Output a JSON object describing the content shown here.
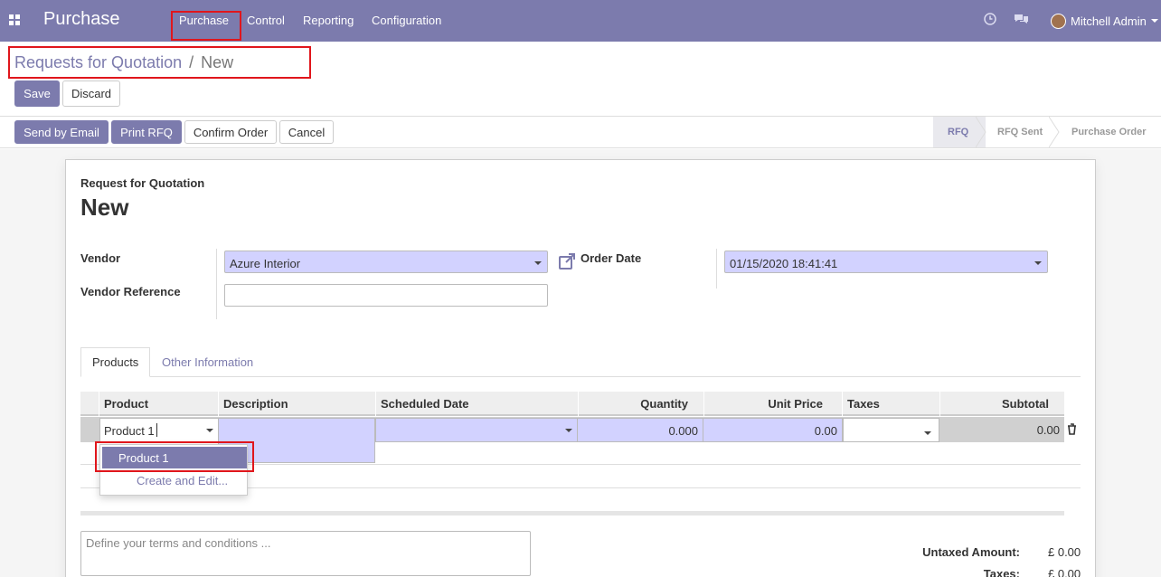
{
  "navbar": {
    "brand": "Purchase",
    "menu": [
      "Purchase",
      "Control",
      "Reporting",
      "Configuration"
    ],
    "user_name": "Mitchell Admin",
    "icons": [
      "apps-grid-icon",
      "clock-icon",
      "chat-icon"
    ]
  },
  "breadcrumb": {
    "parent": "Requests for Quotation",
    "separator": "/",
    "current": "New"
  },
  "actions": {
    "save": "Save",
    "discard": "Discard"
  },
  "header_buttons": {
    "send_email": "Send by Email",
    "print": "Print RFQ",
    "confirm": "Confirm Order",
    "cancel": "Cancel"
  },
  "status_stages": [
    "RFQ",
    "RFQ Sent",
    "Purchase Order"
  ],
  "form": {
    "subtitle": "Request for Quotation",
    "name": "New",
    "vendor_label": "Vendor",
    "vendor_value": "Azure Interior",
    "vendor_ref_label": "Vendor Reference",
    "vendor_ref_value": "",
    "order_date_label": "Order Date",
    "order_date_value": "01/15/2020 18:41:41"
  },
  "tabs": [
    "Products",
    "Other Information"
  ],
  "table": {
    "headers": [
      "Product",
      "Description",
      "Scheduled Date",
      "Quantity",
      "Unit Price",
      "Taxes",
      "Subtotal"
    ],
    "row": {
      "product": "Product 1",
      "description": "",
      "scheduled_date": "",
      "quantity": "0.000",
      "unit_price": "0.00",
      "taxes": "",
      "subtotal": "0.00"
    }
  },
  "autocomplete": {
    "option": "Product 1",
    "create": "Create and Edit..."
  },
  "terms_placeholder": "Define your terms and conditions ...",
  "totals": {
    "untaxed_label": "Untaxed Amount:",
    "untaxed_value": "£ 0.00",
    "taxes_label": "Taxes:",
    "taxes_value": "£ 0.00"
  }
}
